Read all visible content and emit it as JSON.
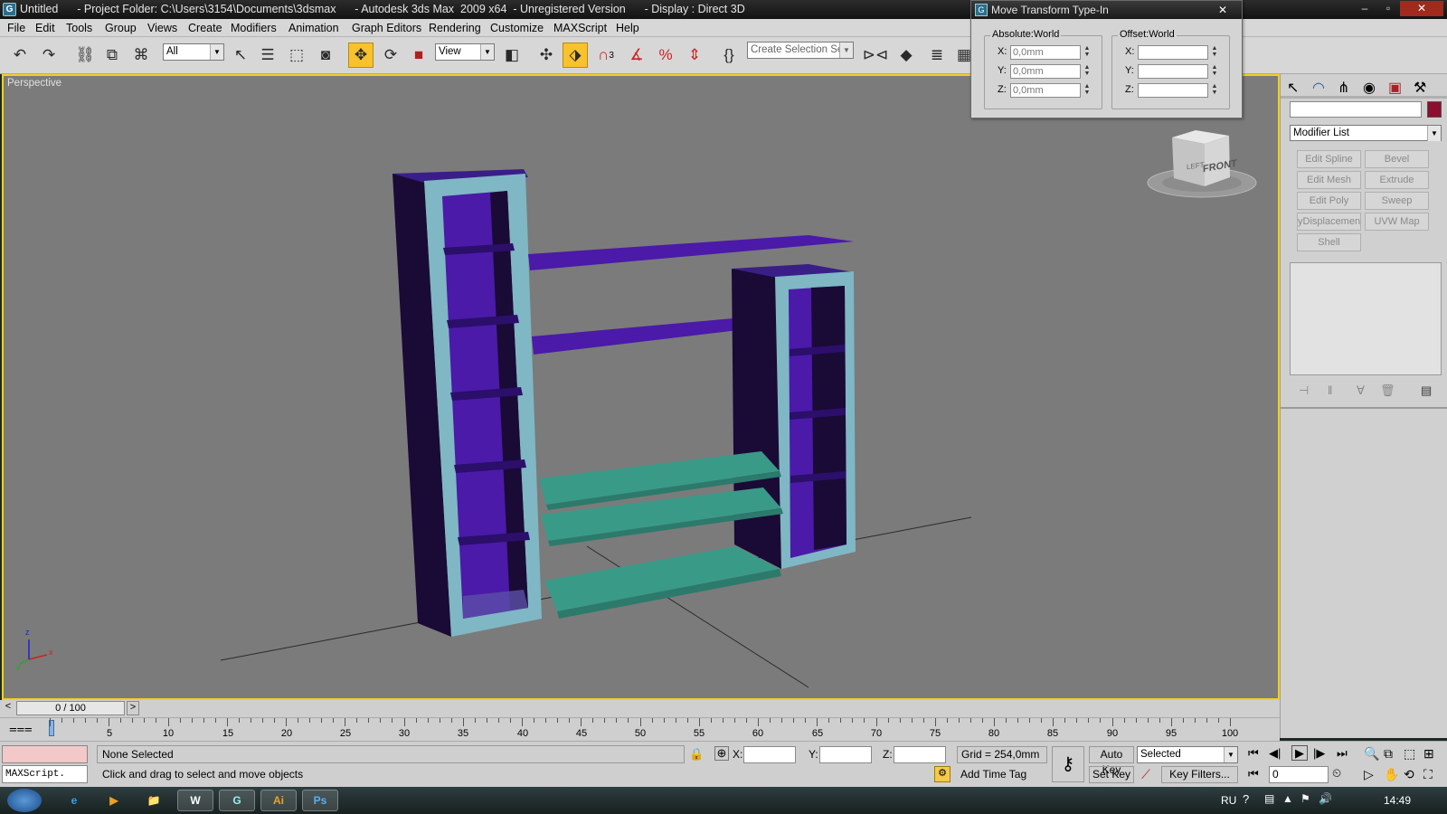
{
  "title_bar": {
    "text": "Untitled      - Project Folder: C:\\Users\\3154\\Documents\\3dsmax      - Autodesk 3ds Max  2009 x64  - Unregistered Version      - Display : Direct 3D",
    "minimize": "–",
    "restore": "▫",
    "close": "✕"
  },
  "menu": [
    "File",
    "Edit",
    "Tools",
    "Group",
    "Views",
    "Create",
    "Modifiers",
    "Animation",
    "Graph Editors",
    "Rendering",
    "Customize",
    "MAXScript",
    "Help"
  ],
  "toolbar": {
    "selection_filter": "All",
    "reference_coord": "View",
    "snap_angle_label": "3",
    "named_selection_placeholder": "Create Selection Set"
  },
  "viewport": {
    "label": "Perspective",
    "viewcube_face": "FRONT",
    "viewcube_side": "LEFT",
    "axis_x": "x",
    "axis_y": "y",
    "axis_z": "z",
    "border_color": "#f2d11b",
    "background_color": "#7b7b7b",
    "shelf_color_purple": "#4b1aa8",
    "shelf_color_teal": "#3a9a88",
    "frame_color": "#7fb7c4"
  },
  "transform_dialog": {
    "title": "Move Transform Type-In",
    "absolute_group": "Absolute:World",
    "offset_group": "Offset:World",
    "x_label": "X:",
    "y_label": "Y:",
    "z_label": "Z:",
    "abs_x": "0,0mm",
    "abs_y": "0,0mm",
    "abs_z": "0,0mm",
    "close": "✕"
  },
  "command_panel": {
    "name_field": "",
    "object_color": "#8b0f2e",
    "modifier_list": "Modifier List",
    "buttons": [
      "Edit Spline",
      "Bevel",
      "Edit Mesh",
      "Extrude",
      "Edit Poly",
      "Sweep",
      "yDisplacement",
      "UVW Map",
      "Shell"
    ]
  },
  "timeline": {
    "frame_display": "0 / 100",
    "prev": "<",
    "next": ">",
    "ticks": [
      "5",
      "10",
      "15",
      "20",
      "25",
      "30",
      "35",
      "40",
      "45",
      "50",
      "55",
      "60",
      "65",
      "70",
      "75",
      "80",
      "85",
      "90",
      "95",
      "100"
    ]
  },
  "status": {
    "selection": "None Selected",
    "prompt": "Click and drag to select and move objects",
    "maxscript": "MAXScript.",
    "x_label": "X:",
    "y_label": "Y:",
    "z_label": "Z:",
    "grid": "Grid = 254,0mm",
    "add_time_tag": "Add Time Tag",
    "auto_key": "Auto Key",
    "set_key": "Set Key",
    "key_mode": "Selected",
    "key_filters": "Key Filters...",
    "current_frame": "0"
  },
  "taskbar": {
    "language": "RU",
    "clock": "14:49",
    "apps": [
      "IE",
      "Media",
      "Explorer",
      "Word",
      "3ds Max",
      "Illustrator",
      "Photoshop"
    ],
    "app_labels": [
      "e",
      "▶",
      "📁",
      "W",
      "G",
      "Ai",
      "Ps"
    ]
  }
}
